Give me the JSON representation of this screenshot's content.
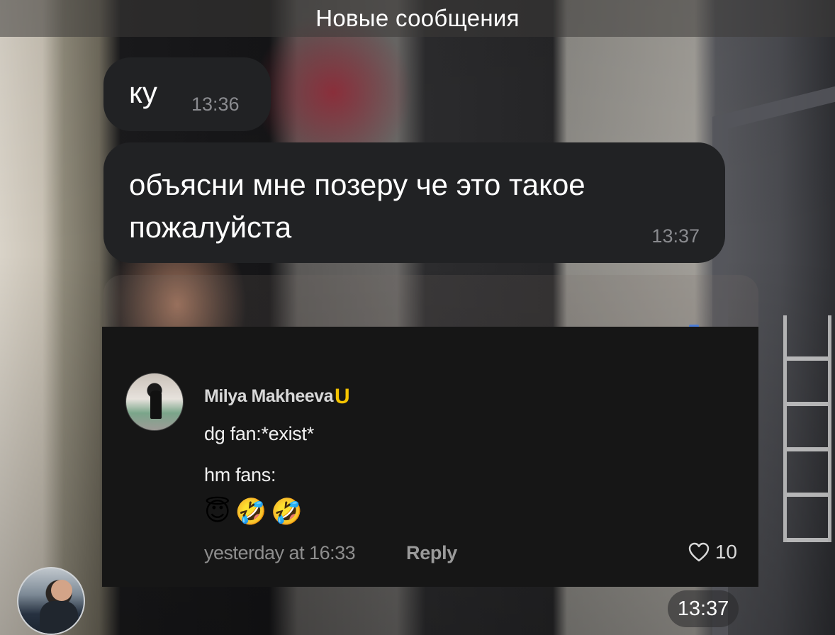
{
  "header": {
    "new_messages_label": "Новые сообщения"
  },
  "messages": [
    {
      "text": "ку",
      "time": "13:36"
    },
    {
      "text": "объясни мне позеру че это такое пожалуйста",
      "time": "13:37"
    }
  ],
  "embedded_comment": {
    "author": "Milya Makheeva",
    "badge": "U",
    "lines": [
      "dg fan:*exist*",
      "hm fans:"
    ],
    "emojis": "😇🤣🤣",
    "timestamp": "yesterday at 16:33",
    "reply_label": "Reply",
    "like_count": "10",
    "badge_color": "#f5c400"
  },
  "media_message": {
    "time": "13:37"
  },
  "icons": {
    "like": "heart-outline-icon"
  }
}
